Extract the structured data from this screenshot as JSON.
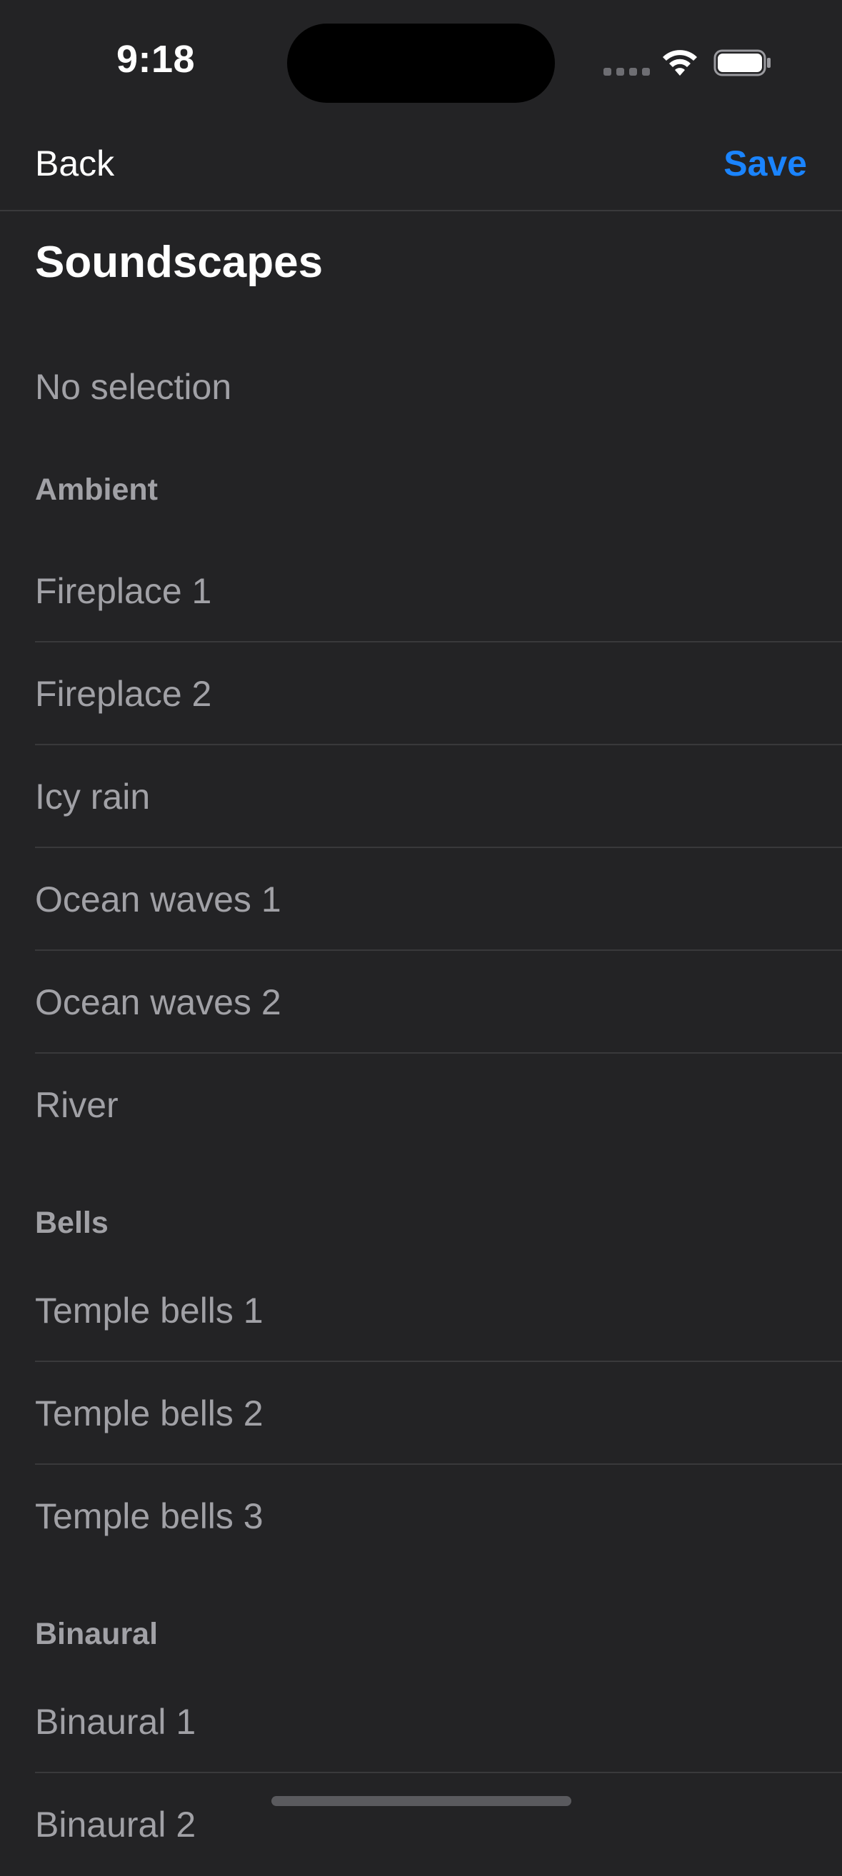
{
  "status_bar": {
    "time": "9:18"
  },
  "nav": {
    "back_label": "Back",
    "save_label": "Save",
    "accent_color": "#1a84ff"
  },
  "page": {
    "title": "Soundscapes"
  },
  "no_selection": {
    "label": "No selection"
  },
  "sections": [
    {
      "header": "Ambient",
      "items": [
        "Fireplace 1",
        "Fireplace 2",
        "Icy rain",
        "Ocean waves 1",
        "Ocean waves 2",
        "River"
      ]
    },
    {
      "header": "Bells",
      "items": [
        "Temple bells 1",
        "Temple bells 2",
        "Temple bells 3"
      ]
    },
    {
      "header": "Binaural",
      "items": [
        "Binaural 1",
        "Binaural 2"
      ]
    }
  ],
  "icons": {
    "signal": "cellular-signal-icon",
    "wifi": "wifi-icon",
    "battery": "battery-icon"
  }
}
